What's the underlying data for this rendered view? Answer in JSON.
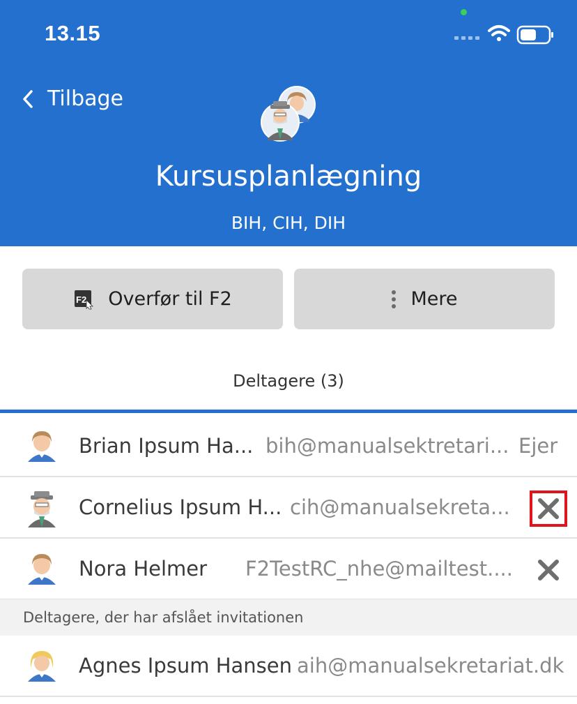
{
  "status_bar": {
    "time": "13.15"
  },
  "nav": {
    "back_label": "Tilbage"
  },
  "header": {
    "title": "Kursusplanlægning",
    "subtitle": "BIH, CIH, DIH"
  },
  "actions": {
    "transfer_label": "Overfør til F2",
    "more_label": "Mere"
  },
  "tab": {
    "label": "Deltagere (3)"
  },
  "participants": [
    {
      "name": "Brian Ipsum Ha...",
      "email": "bih@manualsektretari...",
      "role": "Ejer"
    },
    {
      "name": "Cornelius Ipsum H...",
      "email": "cih@manualsekreta..."
    },
    {
      "name": "Nora Helmer",
      "email": "F2TestRC_nhe@mailtest...."
    }
  ],
  "declined": {
    "header": "Deltagere, der har afslået invitationen",
    "items": [
      {
        "name": "Agnes Ipsum Hansen",
        "email": "aih@manualsekretariat.dk"
      }
    ]
  },
  "colors": {
    "header_bg": "#2470cf",
    "button_bg": "#d8d8d8",
    "highlight": "#e0141d"
  }
}
